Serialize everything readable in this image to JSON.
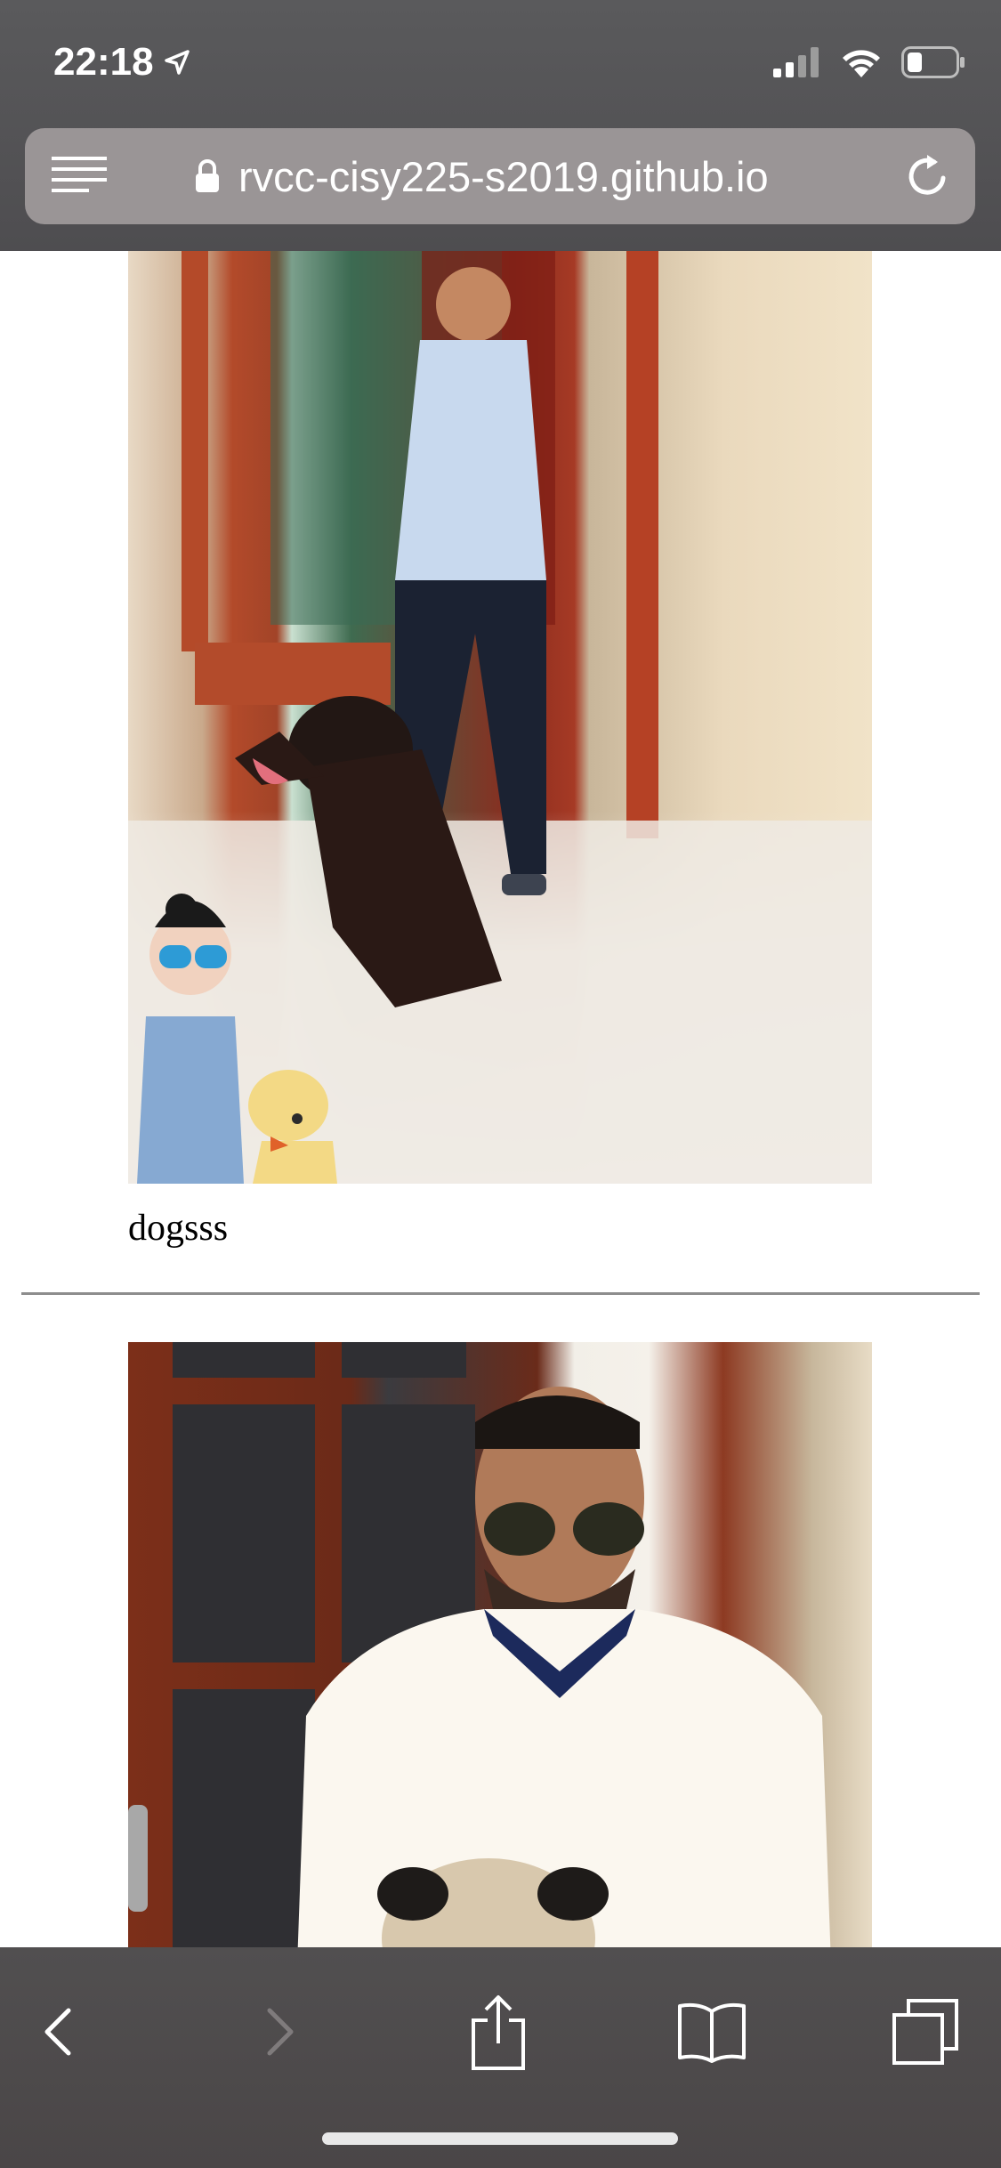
{
  "status": {
    "time": "22:18"
  },
  "browser": {
    "url": "rvcc-cisy225-s2019.github.io"
  },
  "page": {
    "items": [
      {
        "caption": "dogsss"
      }
    ]
  }
}
